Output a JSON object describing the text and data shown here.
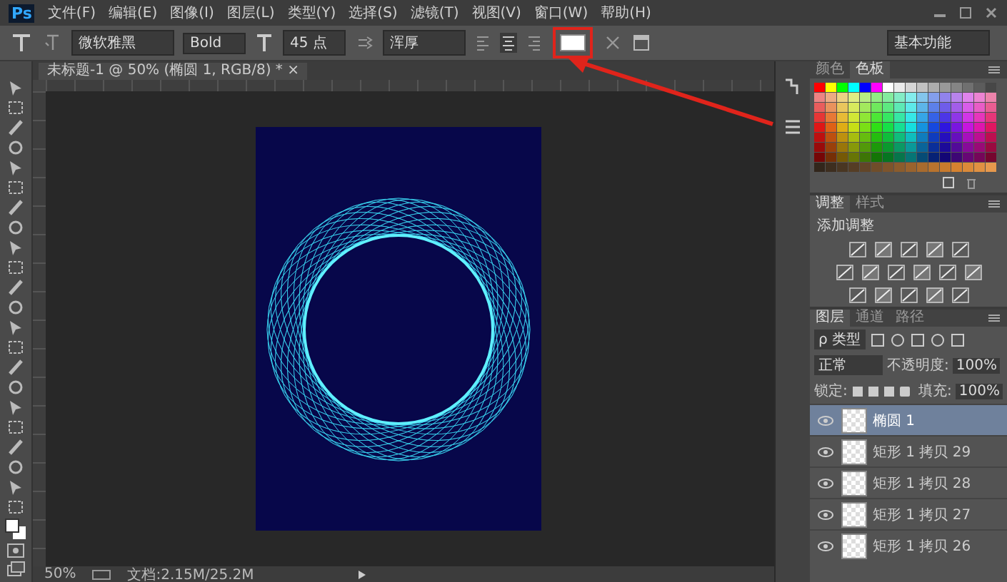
{
  "app": {
    "logo": "Ps"
  },
  "menu": [
    "文件(F)",
    "编辑(E)",
    "图像(I)",
    "图层(L)",
    "类型(Y)",
    "选择(S)",
    "滤镜(T)",
    "视图(V)",
    "窗口(W)",
    "帮助(H)"
  ],
  "options_bar": {
    "font_family": "微软雅黑",
    "font_style": "Bold",
    "font_size": "45 点",
    "antialias": "浑厚",
    "workspace": "基本功能"
  },
  "document": {
    "tab_title": "未标题-1 @ 50% (椭圆 1, RGB/8) *",
    "close": "×"
  },
  "swatches_panel": {
    "tabs": [
      {
        "label": "颜色",
        "selected": false
      },
      {
        "label": "色板",
        "selected": true
      }
    ]
  },
  "adjustments_panel": {
    "tabs": [
      {
        "label": "调整",
        "selected": true
      },
      {
        "label": "样式",
        "selected": false
      }
    ],
    "heading": "添加调整"
  },
  "layers_panel": {
    "tabs": [
      {
        "label": "图层",
        "selected": true
      },
      {
        "label": "通道",
        "selected": false
      },
      {
        "label": "路径",
        "selected": false
      }
    ],
    "filter": "ρ 类型",
    "blend_mode": "正常",
    "opacity_label": "不透明度:",
    "opacity": "100%",
    "lock_label": "锁定:",
    "fill_label": "填充:",
    "fill": "100%",
    "layers": [
      {
        "name": "椭圆 1",
        "visible": true,
        "selected": true
      },
      {
        "name": "矩形 1 拷贝 29",
        "visible": true,
        "selected": false
      },
      {
        "name": "矩形 1 拷贝 28",
        "visible": true,
        "selected": false
      },
      {
        "name": "矩形 1 拷贝 27",
        "visible": true,
        "selected": false
      },
      {
        "name": "矩形 1 拷贝 26",
        "visible": true,
        "selected": false
      }
    ]
  },
  "status_bar": {
    "zoom": "50%",
    "doc_size": "文档:2.15M/25.2M"
  }
}
